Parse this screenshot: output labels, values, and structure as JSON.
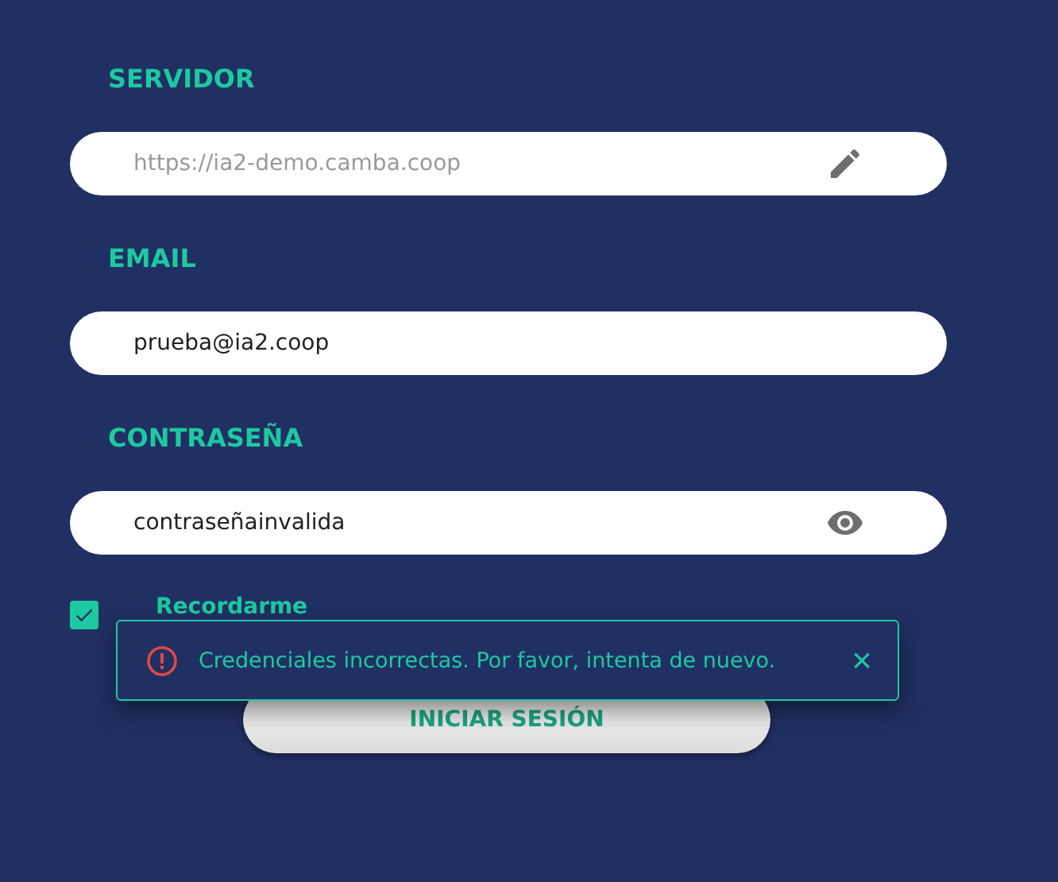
{
  "fields": [
    {
      "label": "SERVIDOR",
      "value": "https://ia2-demo.camba.coop",
      "disabled": true,
      "kind": "edit"
    },
    {
      "label": "EMAIL",
      "value": "prueba@ia2.coop",
      "disabled": false,
      "kind": "plain"
    },
    {
      "label": "CONTRASEÑA",
      "value": "contraseñainvalida",
      "disabled": false,
      "kind": "reveal"
    }
  ],
  "remember": {
    "label": "Recordarme",
    "checked": true
  },
  "submit": {
    "label": "INICIAR SESIÓN"
  },
  "toast": {
    "message": "Credenciales incorrectas. Por favor, intenta de nuevo.",
    "close": "×"
  }
}
